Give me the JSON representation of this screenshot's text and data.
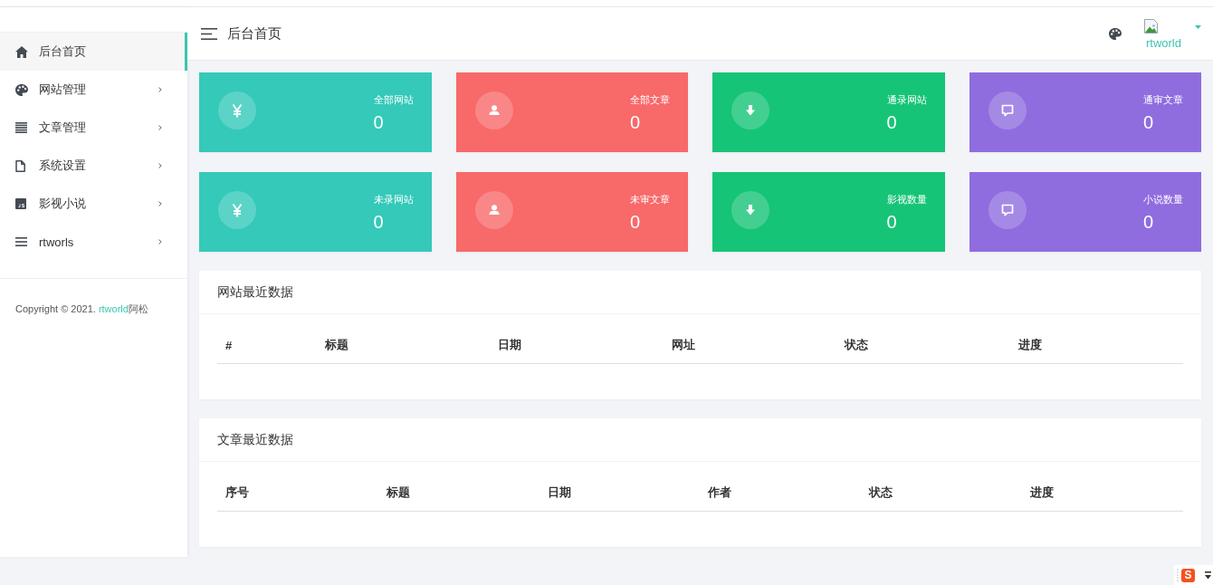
{
  "sidebar": {
    "items": [
      {
        "label": "后台首页",
        "selected": true,
        "has_submenu": false
      },
      {
        "label": "网站管理",
        "selected": false,
        "has_submenu": true
      },
      {
        "label": "文章管理",
        "selected": false,
        "has_submenu": true
      },
      {
        "label": "系统设置",
        "selected": false,
        "has_submenu": true
      },
      {
        "label": "影视小说",
        "selected": false,
        "has_submenu": true
      },
      {
        "label": "rtworls",
        "selected": false,
        "has_submenu": true
      }
    ],
    "copyright": {
      "prefix": "Copyright © 2021. ",
      "link": "rtworld",
      "suffix": "阿松"
    }
  },
  "header": {
    "title": "后台首页",
    "user": {
      "name": "rtworld"
    }
  },
  "stat_cards": [
    {
      "label": "全部网站",
      "value": "0",
      "color": "#34c9b9"
    },
    {
      "label": "全部文章",
      "value": "0",
      "color": "#f86969"
    },
    {
      "label": "通录网站",
      "value": "0",
      "color": "#16c477"
    },
    {
      "label": "通审文章",
      "value": "0",
      "color": "#8f6ddf"
    },
    {
      "label": "未录网站",
      "value": "0",
      "color": "#34c9b9"
    },
    {
      "label": "未审文章",
      "value": "0",
      "color": "#f86969"
    },
    {
      "label": "影视数量",
      "value": "0",
      "color": "#16c477"
    },
    {
      "label": "小说数量",
      "value": "0",
      "color": "#8f6ddf"
    }
  ],
  "panels": [
    {
      "title": "网站最近数据",
      "columns": [
        "#",
        "标题",
        "日期",
        "网址",
        "状态",
        "进度"
      ]
    },
    {
      "title": "文章最近数据",
      "columns": [
        "序号",
        "标题",
        "日期",
        "作者",
        "状态",
        "进度"
      ]
    }
  ],
  "ime_toolbar": {
    "logo": "S"
  }
}
